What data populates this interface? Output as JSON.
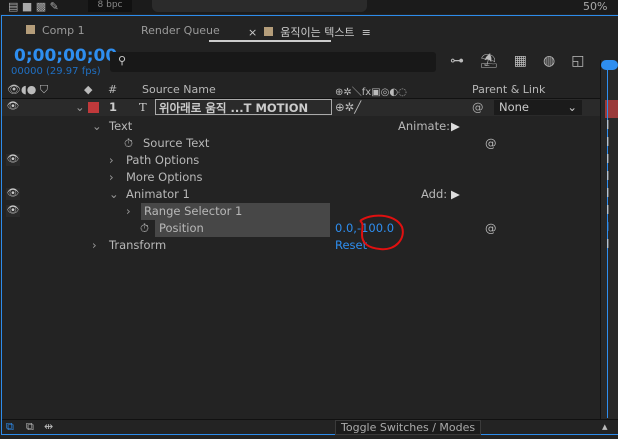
{
  "topbar": {
    "bpc": "8 bpc",
    "zoom": "50%"
  },
  "tabs": [
    {
      "label": "Comp 1"
    },
    {
      "label": "Render Queue"
    },
    {
      "label": "움직이는 텍스트",
      "active": true
    }
  ],
  "tab_close": "×",
  "tab_menu": "≡",
  "timecode": "0;00;00;00",
  "frames": "00000 (29.97 fps)",
  "search": {
    "placeholder": "",
    "icon": "⚲"
  },
  "headers": {
    "num": "#",
    "source_name": "Source Name",
    "parent_link": "Parent & Link",
    "switches": "⊕✲＼fx▣◎◐◌"
  },
  "layer": {
    "number": "1",
    "type": "T",
    "name": "위아래로 움직 ...T MOTION",
    "parent": "None",
    "label_color": "#c0393b"
  },
  "props": [
    {
      "label": "Text",
      "extra": "Animate:"
    },
    {
      "label": "Source Text"
    },
    {
      "label": "Path Options"
    },
    {
      "label": "More Options"
    },
    {
      "label": "Animator 1",
      "extra": "Add:"
    },
    {
      "label": "Range Selector 1"
    },
    {
      "label": "Position",
      "value": "0.0,-100.0"
    },
    {
      "label": "Transform",
      "value": "Reset"
    }
  ],
  "footer": {
    "toggle": "Toggle Switches / Modes"
  },
  "colors": {
    "accent": "#2e8ef0",
    "annotation": "#e01010"
  }
}
